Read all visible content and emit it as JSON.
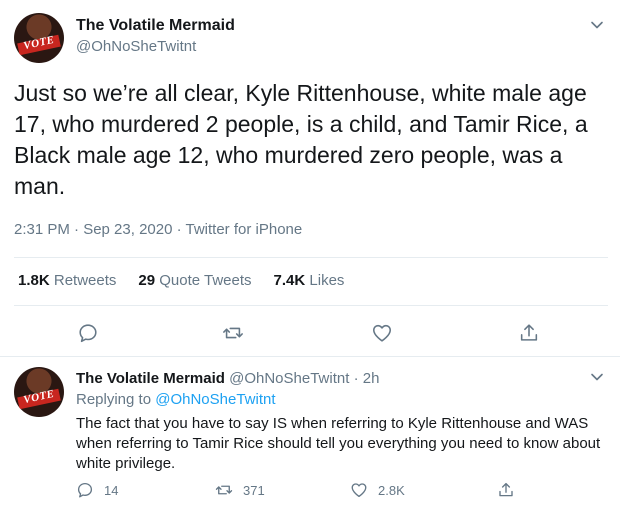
{
  "main_tweet": {
    "author_name": "The Volatile Mermaid",
    "author_handle": "@OhNoSheTwitnt",
    "avatar_text": "VOTE",
    "text": "Just so we’re all clear, Kyle Rittenhouse, white male age 17, who murdered 2 people, is a child, and Tamir Rice, a Black male age 12, who murdered zero people, was a man.",
    "timestamp": "2:31 PM · Sep 23, 2020 · Twitter for iPhone",
    "stats": {
      "retweets_count": "1.8K",
      "retweets_label": "Retweets",
      "quotes_count": "29",
      "quotes_label": "Quote Tweets",
      "likes_count": "7.4K",
      "likes_label": "Likes"
    }
  },
  "reply_tweet": {
    "author_name": "The Volatile Mermaid",
    "author_handle": "@OhNoSheTwitnt",
    "time_ago": "· 2h",
    "avatar_text": "VOTE",
    "replying_prefix": "Replying to",
    "replying_to": "@OhNoSheTwitnt",
    "text": "The fact that you have to say IS when referring to Kyle Rittenhouse and WAS when referring to Tamir Rice should tell you everything you need to know about white privilege.",
    "reply_count": "14",
    "retweet_count": "371",
    "like_count": "2.8K"
  },
  "icons": {
    "reply": "reply-icon",
    "retweet": "retweet-icon",
    "like": "heart-icon",
    "share": "share-icon",
    "more": "chevron-down-icon"
  },
  "colors": {
    "text_primary": "#14171a",
    "text_secondary": "#657786",
    "link": "#1da1f2",
    "divider": "#e6ecf0"
  }
}
